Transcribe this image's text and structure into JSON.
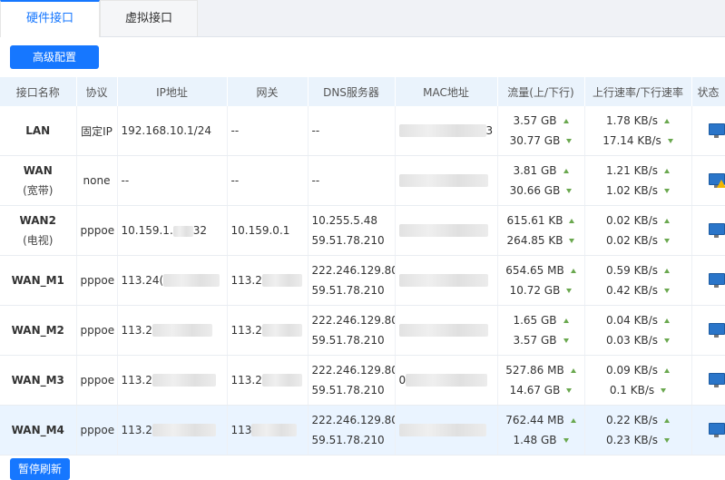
{
  "tabs": [
    {
      "label": "硬件接口",
      "active": true
    },
    {
      "label": "虚拟接口",
      "active": false
    }
  ],
  "advanced_button": "高级配置",
  "pause_button": "暂停刷新",
  "columns": [
    "接口名称",
    "协议",
    "IP地址",
    "网关",
    "DNS服务器",
    "MAC地址",
    "流量(上/下行)",
    "上行速率/下行速率",
    "状态"
  ],
  "rows": [
    {
      "name": "LAN",
      "sub": "",
      "protocol": "固定IP",
      "ip": "192.168.10.1/24",
      "gateway": "--",
      "dns1": "--",
      "dns2": "",
      "mac": "3",
      "traffic_up": "3.57 GB",
      "traffic_down": "30.77 GB",
      "rate_up": "1.78 KB/s",
      "rate_down": "17.14 KB/s",
      "status_icon": "monitor-icon"
    },
    {
      "name": "WAN",
      "sub": "(宽带)",
      "protocol": "none",
      "ip": "--",
      "gateway": "--",
      "dns1": "--",
      "dns2": "",
      "mac": "",
      "traffic_up": "3.81 GB",
      "traffic_down": "30.66 GB",
      "rate_up": "1.21 KB/s",
      "rate_down": "1.02 KB/s",
      "status_icon": "monitor-warning-icon"
    },
    {
      "name": "WAN2",
      "sub": "(电视)",
      "protocol": "pppoe",
      "ip": "10.159.1.",
      "ip_tail": "32",
      "gateway": "10.159.0.1",
      "dns1": "10.255.5.48",
      "dns2": "59.51.78.210",
      "mac": "",
      "traffic_up": "615.61 KB",
      "traffic_down": "264.85 KB",
      "rate_up": "0.02 KB/s",
      "rate_down": "0.02 KB/s",
      "status_icon": "monitor-icon"
    },
    {
      "name": "WAN_M1",
      "sub": "",
      "protocol": "pppoe",
      "ip": "113.24(",
      "gateway": "113.2",
      "dns1": "222.246.129.80",
      "dns2": "59.51.78.210",
      "mac": "",
      "traffic_up": "654.65 MB",
      "traffic_down": "10.72 GB",
      "rate_up": "0.59 KB/s",
      "rate_down": "0.42 KB/s",
      "status_icon": "monitor-icon"
    },
    {
      "name": "WAN_M2",
      "sub": "",
      "protocol": "pppoe",
      "ip": "113.2",
      "gateway": "113.2",
      "dns1": "222.246.129.80",
      "dns2": "59.51.78.210",
      "mac": "",
      "traffic_up": "1.65 GB",
      "traffic_down": "3.57 GB",
      "rate_up": "0.04 KB/s",
      "rate_down": "0.03 KB/s",
      "status_icon": "monitor-icon"
    },
    {
      "name": "WAN_M3",
      "sub": "",
      "protocol": "pppoe",
      "ip": "113.2",
      "gateway": "113.2",
      "dns1": "222.246.129.80",
      "dns2": "59.51.78.210",
      "mac": "0",
      "traffic_up": "527.86 MB",
      "traffic_down": "14.67 GB",
      "rate_up": "0.09 KB/s",
      "rate_down": "0.1 KB/s",
      "status_icon": "monitor-icon"
    },
    {
      "name": "WAN_M4",
      "sub": "",
      "protocol": "pppoe",
      "ip": "113.2",
      "gateway": "113",
      "dns1": "222.246.129.80",
      "dns2": "59.51.78.210",
      "mac": "",
      "traffic_up": "762.44 MB",
      "traffic_down": "1.48 GB",
      "rate_up": "0.22 KB/s",
      "rate_down": "0.23 KB/s",
      "status_icon": "monitor-icon",
      "highlight": true
    }
  ],
  "colors": {
    "accent": "#1677ff",
    "header_bg": "#eaf3fc",
    "arrow": "#6aa84f",
    "highlight_row": "#eaf4ff"
  }
}
